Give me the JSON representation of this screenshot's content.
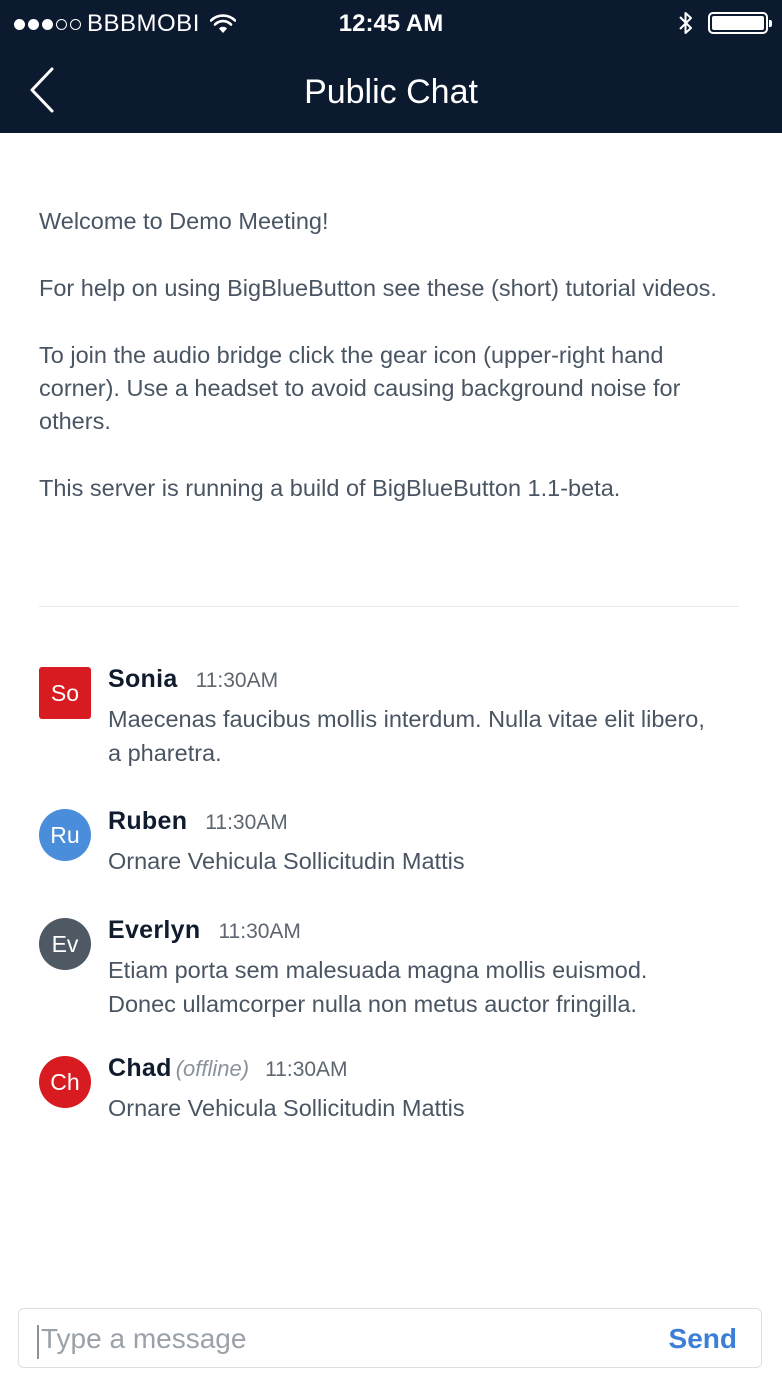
{
  "status_bar": {
    "carrier": "BBBMOBI",
    "time": "12:45 AM",
    "signal_bars_filled": 3,
    "signal_bars_total": 5,
    "battery_level": 1.0
  },
  "nav": {
    "title": "Public Chat",
    "back_icon": "chevron-left-icon"
  },
  "welcome": {
    "line1": "Welcome to Demo Meeting!",
    "line2": "For help on using BigBlueButton see these (short) tutorial videos.",
    "line3": "To join the audio bridge click the gear icon (upper-right hand corner). Use a headset to avoid causing background noise for others.",
    "line4": "This server is running a build of BigBlueButton 1.1-beta."
  },
  "messages": [
    {
      "initials": "So",
      "avatar_color": "#d81b21",
      "avatar_shape": "square",
      "name": "Sonia",
      "status": "",
      "time": "11:30AM",
      "text": "Maecenas faucibus mollis interdum. Nulla vitae elit libero, a pharetra."
    },
    {
      "initials": "Ru",
      "avatar_color": "#4a8ddb",
      "avatar_shape": "circle",
      "name": "Ruben",
      "status": "",
      "time": "11:30AM",
      "text": "Ornare Vehicula Sollicitudin Mattis"
    },
    {
      "initials": "Ev",
      "avatar_color": "#4f5964",
      "avatar_shape": "circle",
      "name": "Everlyn",
      "status": "",
      "time": "11:30AM",
      "text": "Etiam porta sem malesuada magna  mollis euismod. Donec ullamcorper  nulla non metus auctor fringilla."
    },
    {
      "initials": "Ch",
      "avatar_color": "#d81b21",
      "avatar_shape": "circle",
      "name": "Chad",
      "status": "(offline)",
      "time": "11:30AM",
      "text": "Ornare Vehicula Sollicitudin Mattis"
    }
  ],
  "composer": {
    "placeholder": "Type a message",
    "value": "",
    "send_label": "Send"
  },
  "colors": {
    "header_bg": "#0c1a2f",
    "accent": "#3d7fd6",
    "text": "#4a5563"
  }
}
